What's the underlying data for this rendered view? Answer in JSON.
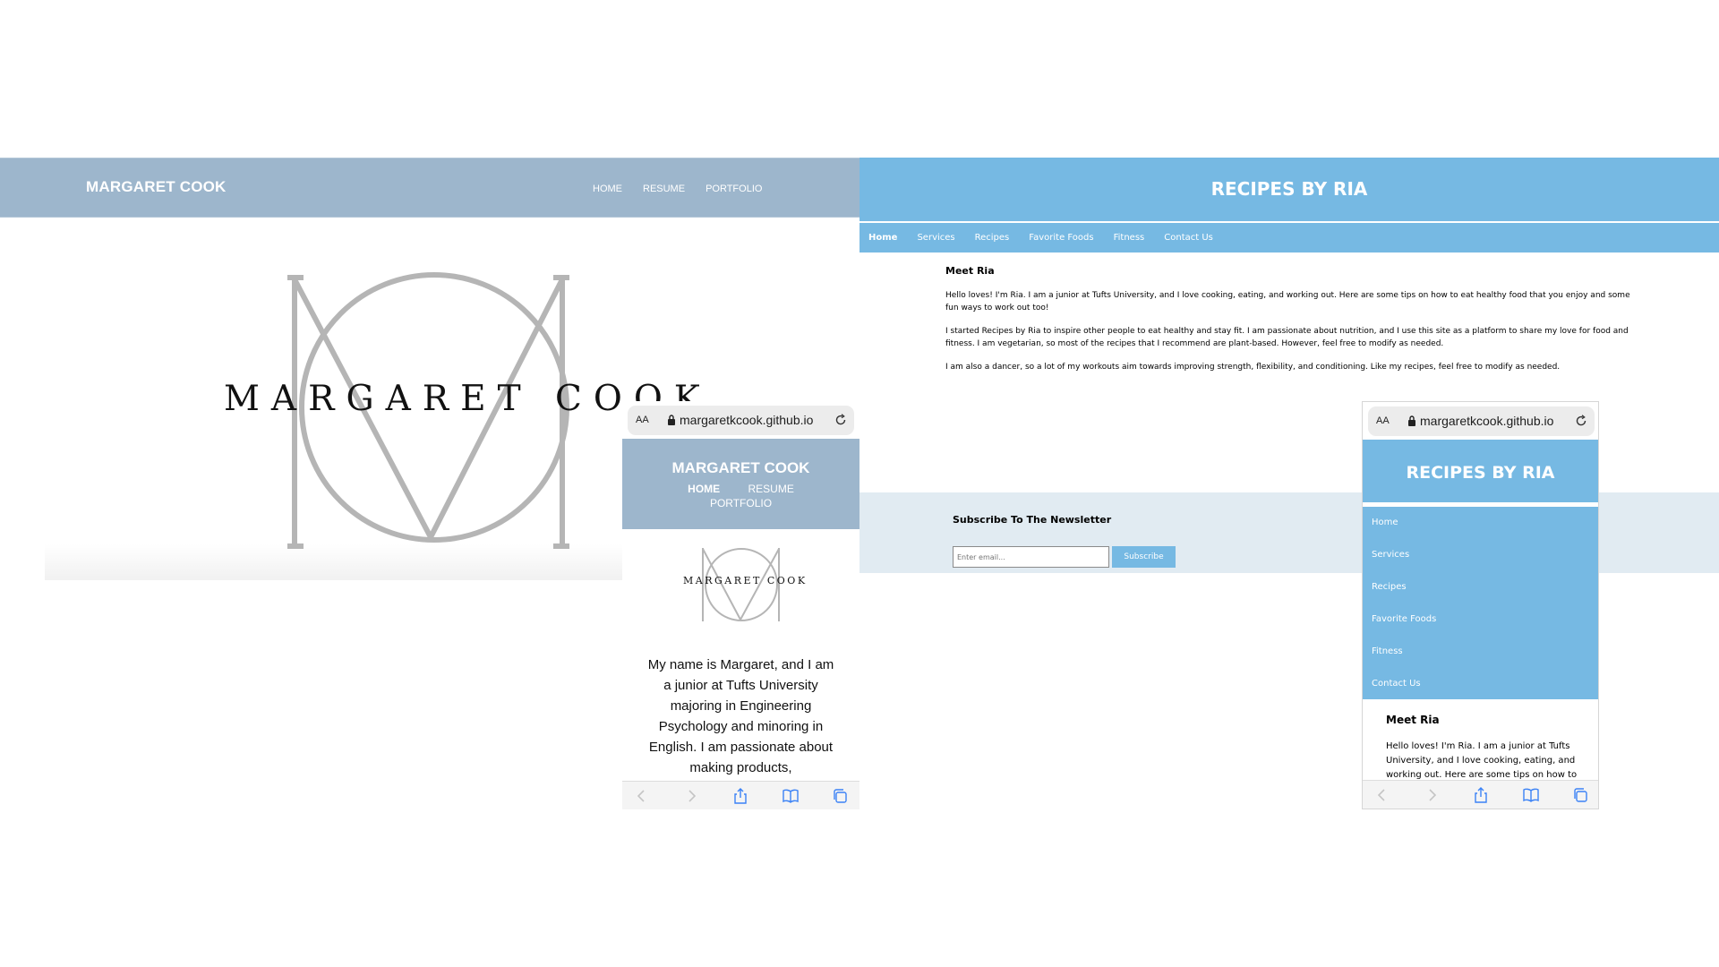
{
  "margaret_desktop": {
    "brand": "MARGARET COOK",
    "nav": [
      "HOME",
      "RESUME",
      "PORTFOLIO"
    ],
    "logo_text": "MARGARET COOK"
  },
  "margaret_mobile": {
    "url": "margaretkcook.github.io",
    "aa_label": "AA",
    "brand": "MARGARET COOK",
    "nav_home": "HOME",
    "nav_resume": "RESUME",
    "nav_portfolio": "PORTFOLIO",
    "logo_text": "MARGARET COOK",
    "bio": "My name is Margaret, and I am a junior at Tufts University majoring in Engineering Psychology and minoring in English. I am passionate about making products,"
  },
  "ria_desktop": {
    "title": "RECIPES BY RIA",
    "nav": [
      "Home",
      "Services",
      "Recipes",
      "Favorite Foods",
      "Fitness",
      "Contact Us"
    ],
    "heading": "Meet Ria",
    "paragraphs": [
      "Hello loves! I'm Ria. I am a junior at Tufts University, and I love cooking, eating, and working out. Here are some tips on how to eat healthy food that you enjoy and some fun ways to work out too!",
      "I started Recipes by Ria to inspire other people to eat healthy and stay fit. I am passionate about nutrition, and I use this site as a platform to share my love for food and fitness. I am vegetarian, so most of the recipes that I recommend are plant-based. However, feel free to modify as needed.",
      "I am also a dancer, so a lot of my workouts aim towards improving strength, flexibility, and conditioning. Like my recipes, feel free to modify as needed."
    ],
    "newsletter_title": "Subscribe To The Newsletter",
    "email_placeholder": "Enter email...",
    "subscribe_label": "Subscribe"
  },
  "ria_mobile": {
    "url": "margaretkcook.github.io",
    "aa_label": "AA",
    "title": "RECIPES BY RIA",
    "menu": [
      "Home",
      "Services",
      "Recipes",
      "Favorite Foods",
      "Fitness",
      "Contact Us"
    ],
    "heading": "Meet Ria",
    "para": "Hello loves! I'm Ria. I am a junior at Tufts University, and I love cooking, eating, and working out. Here are some tips on how to"
  },
  "colors": {
    "margaret_blue": "#9db6cc",
    "ria_blue": "#76b9e3",
    "footer_bg": "#e1ebf2"
  },
  "icons": [
    "lock-icon",
    "reload-icon",
    "back-icon",
    "forward-icon",
    "share-icon",
    "bookmarks-icon",
    "tabs-icon"
  ]
}
